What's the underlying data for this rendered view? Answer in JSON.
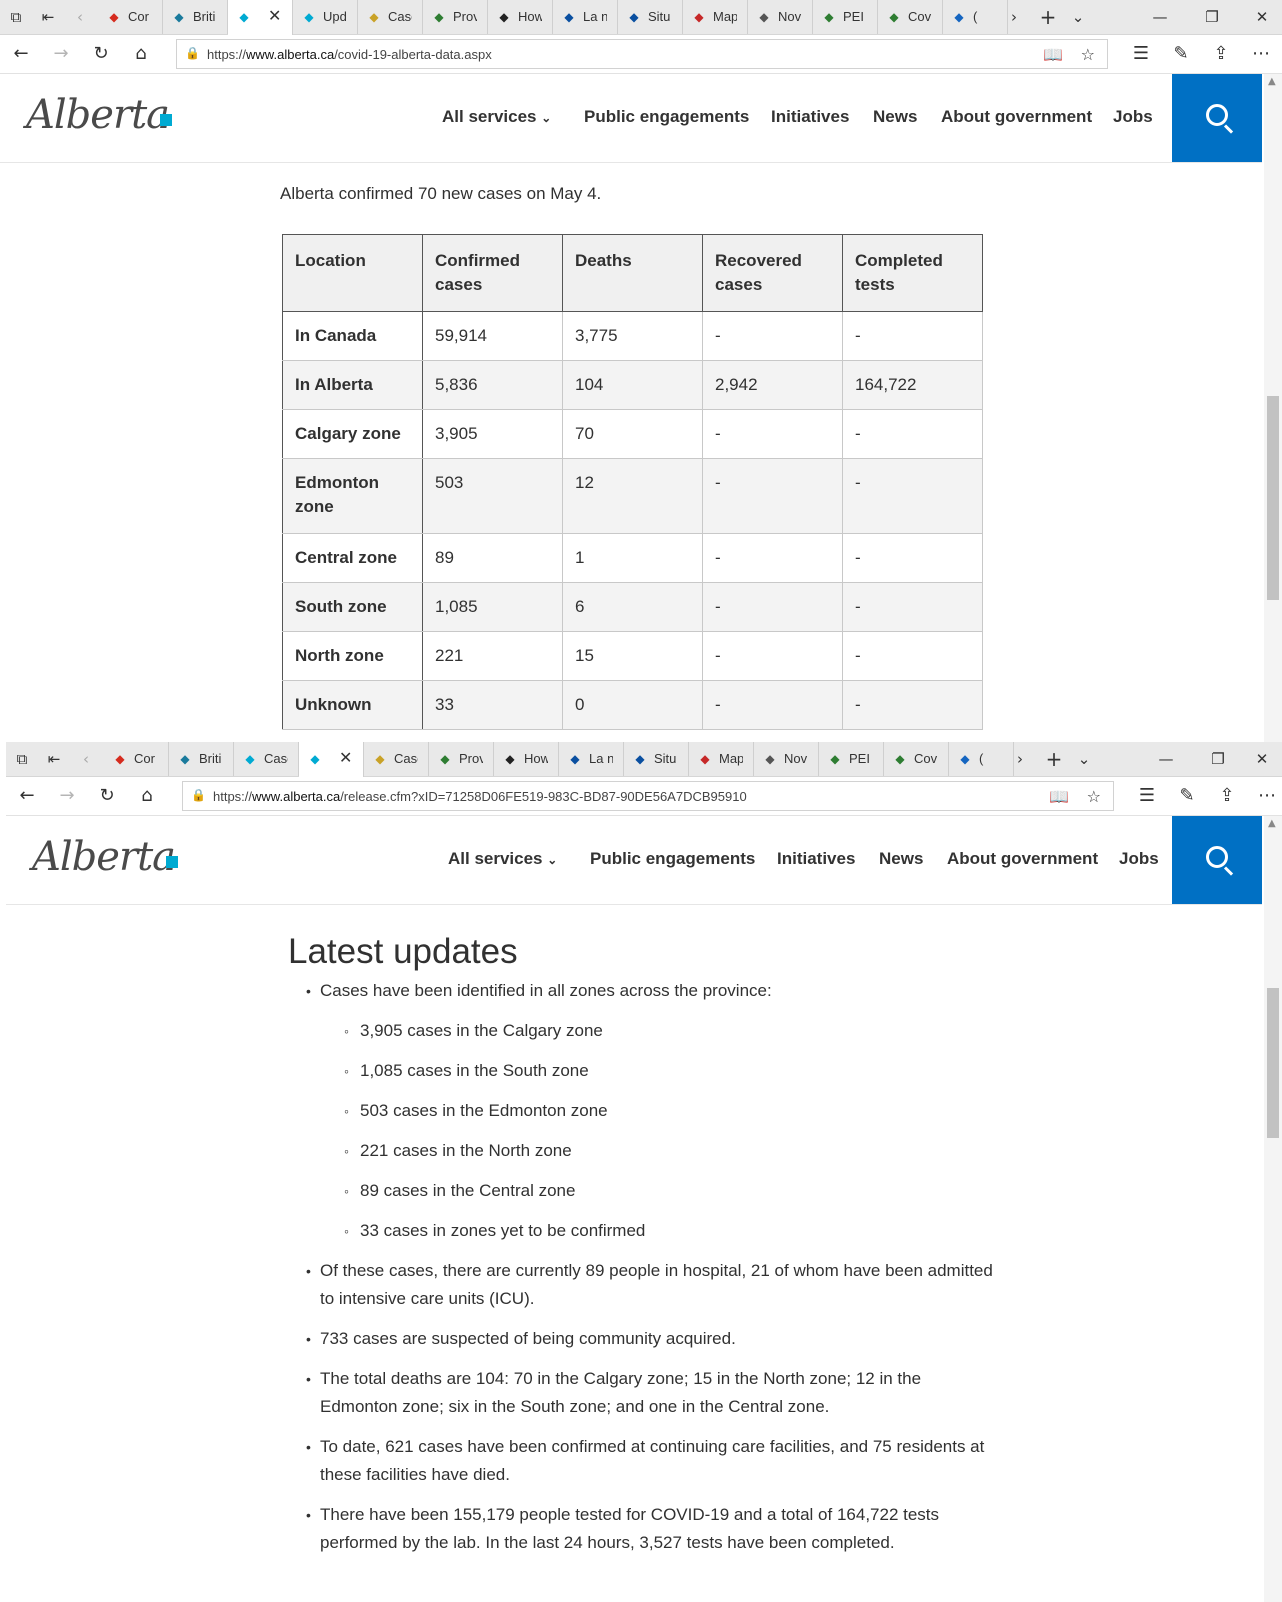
{
  "window1": {
    "tabs": [
      {
        "title": "Cor",
        "icon": "canada-leaf-icon",
        "fav_color": "#d52b1e"
      },
      {
        "title": "Briti",
        "icon": "bc-icon",
        "fav_color": "#1a7a9c"
      },
      {
        "title": "",
        "icon": "alberta-icon",
        "fav_color": "#00aad2",
        "active": true
      },
      {
        "title": "Upd",
        "icon": "alberta-icon",
        "fav_color": "#00aad2"
      },
      {
        "title": "Case",
        "icon": "sask-icon",
        "fav_color": "#c9a227"
      },
      {
        "title": "Prov",
        "icon": "manitoba-icon",
        "fav_color": "#2e7d32"
      },
      {
        "title": "How",
        "icon": "ontario-icon",
        "fav_color": "#222222"
      },
      {
        "title": "La n",
        "icon": "quebec-icon",
        "fav_color": "#0a4fa0"
      },
      {
        "title": "Situ",
        "icon": "quebec-icon",
        "fav_color": "#0a4fa0"
      },
      {
        "title": "Map",
        "icon": "nb-icon",
        "fav_color": "#c62828"
      },
      {
        "title": "Nov",
        "icon": "ns-icon",
        "fav_color": "#555555"
      },
      {
        "title": "PEI",
        "icon": "pei-icon",
        "fav_color": "#2e7d32"
      },
      {
        "title": "Cov",
        "icon": "nl-icon",
        "fav_color": "#2e7d32"
      },
      {
        "title": "(",
        "icon": "yukon-icon",
        "fav_color": "#1565c0"
      }
    ],
    "url_prefix": "https://",
    "url_domain": "www.alberta.ca",
    "url_path": "/covid-19-alberta-data.aspx"
  },
  "window2": {
    "tabs": [
      {
        "title": "Cor",
        "icon": "canada-leaf-icon",
        "fav_color": "#d52b1e"
      },
      {
        "title": "Briti",
        "icon": "bc-icon",
        "fav_color": "#1a7a9c"
      },
      {
        "title": "Case",
        "icon": "alberta-icon",
        "fav_color": "#00aad2"
      },
      {
        "title": "",
        "icon": "alberta-icon",
        "fav_color": "#00aad2",
        "active": true
      },
      {
        "title": "Case",
        "icon": "sask-icon",
        "fav_color": "#c9a227"
      },
      {
        "title": "Prov",
        "icon": "manitoba-icon",
        "fav_color": "#2e7d32"
      },
      {
        "title": "How",
        "icon": "ontario-icon",
        "fav_color": "#222222"
      },
      {
        "title": "La n",
        "icon": "quebec-icon",
        "fav_color": "#0a4fa0"
      },
      {
        "title": "Situ",
        "icon": "quebec-icon",
        "fav_color": "#0a4fa0"
      },
      {
        "title": "Map",
        "icon": "nb-icon",
        "fav_color": "#c62828"
      },
      {
        "title": "Nov",
        "icon": "ns-icon",
        "fav_color": "#555555"
      },
      {
        "title": "PEI",
        "icon": "pei-icon",
        "fav_color": "#2e7d32"
      },
      {
        "title": "Cov",
        "icon": "nl-icon",
        "fav_color": "#2e7d32"
      },
      {
        "title": "(",
        "icon": "yukon-icon",
        "fav_color": "#1565c0"
      }
    ],
    "url_prefix": "https://",
    "url_domain": "www.alberta.ca",
    "url_path": "/release.cfm?xID=71258D06FE519-983C-BD87-90DE56A7DCB95910"
  },
  "site": {
    "logo_text": "Alberta",
    "brand_color": "#0070c4",
    "nav": [
      "All services",
      "Public engagements",
      "Initiatives",
      "News",
      "About government",
      "Jobs"
    ]
  },
  "data_page": {
    "intro": "Alberta confirmed 70 new cases on May 4.",
    "table": {
      "headers": [
        "Location",
        "Confirmed cases",
        "Deaths",
        "Recovered cases",
        "Completed tests"
      ],
      "rows": [
        [
          "In Canada",
          "59,914",
          "3,775",
          "-",
          "-"
        ],
        [
          "In Alberta",
          "5,836",
          "104",
          "2,942",
          "164,722"
        ],
        [
          "Calgary zone",
          "3,905",
          "70",
          "-",
          "-"
        ],
        [
          "Edmonton zone",
          "503",
          "12",
          "-",
          "-"
        ],
        [
          "Central zone",
          "89",
          "1",
          "-",
          "-"
        ],
        [
          "South zone",
          "1,085",
          "6",
          "-",
          "-"
        ],
        [
          "North zone",
          "221",
          "15",
          "-",
          "-"
        ],
        [
          "Unknown",
          "33",
          "0",
          "-",
          "-"
        ]
      ]
    }
  },
  "release_page": {
    "heading": "Latest updates",
    "bullets": [
      "Cases have been identified in all zones across the province:",
      "Of these cases, there are currently 89 people in hospital, 21 of whom have been admitted to intensive care units (ICU).",
      "733 cases are suspected of being community acquired.",
      "The total deaths are 104: 70 in the Calgary zone; 15 in the North zone; 12 in the Edmonton zone; six in the South zone; and one in the Central zone.",
      "To date, 621 cases have been confirmed at continuing care facilities, and 75 residents at these facilities have died.",
      "There have been 155,179 people tested for COVID-19 and a total of 164,722 tests performed by the lab. In the last 24 hours, 3,527 tests have been completed."
    ],
    "zone_cases": [
      "3,905 cases in the Calgary zone",
      "1,085 cases in the South zone",
      "503 cases in the Edmonton zone",
      "221 cases in the North zone",
      "89 cases in the Central zone",
      "33 cases in zones yet to be confirmed"
    ]
  }
}
